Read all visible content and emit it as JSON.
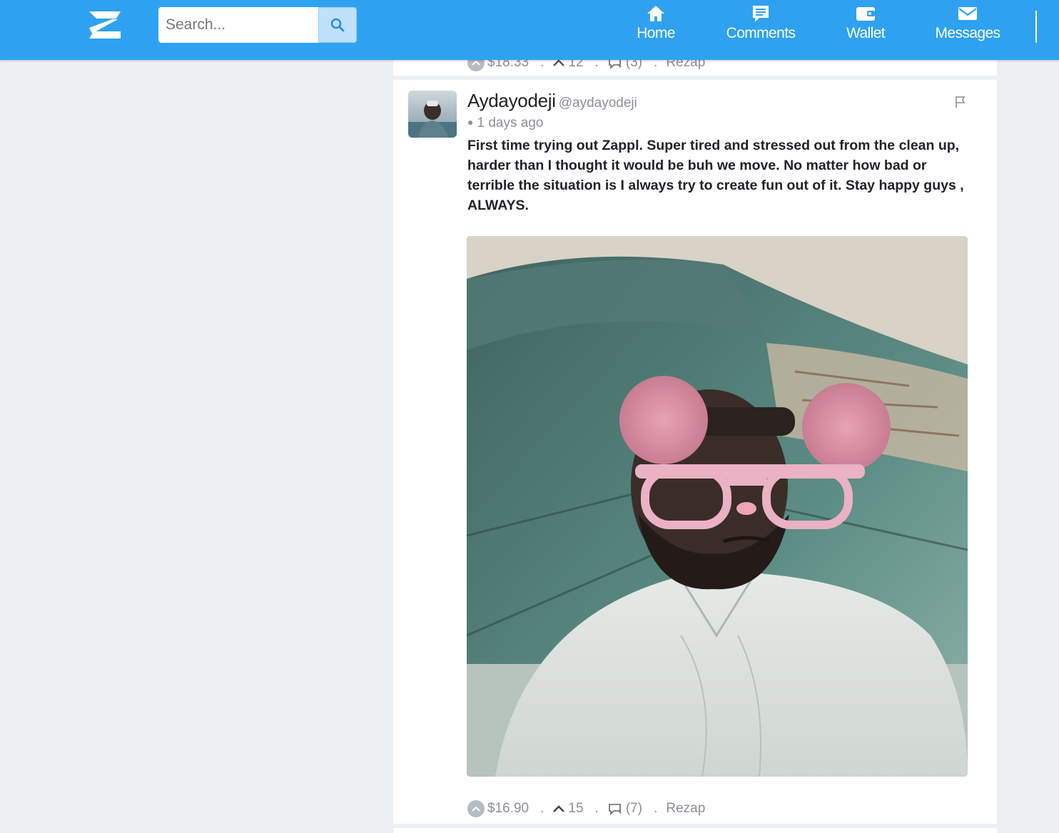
{
  "app": {
    "name": "Zappl"
  },
  "search": {
    "placeholder": "Search..."
  },
  "nav": {
    "items": [
      {
        "label": "Home",
        "icon": "home-icon"
      },
      {
        "label": "Comments",
        "icon": "comment-icon"
      },
      {
        "label": "Wallet",
        "icon": "wallet-icon"
      },
      {
        "label": "Messages",
        "icon": "envelope-icon"
      }
    ]
  },
  "previous_post": {
    "payout": "$18.33",
    "upvotes": "12",
    "comments": "(3)",
    "rezap": "Rezap"
  },
  "post": {
    "author_name": "Aydayodeji",
    "author_handle": "@aydayodeji",
    "time": "1 days ago",
    "text": "First time trying out Zappl. Super tired and stressed out from the clean up, harder than I thought it would be buh we move. No matter how bad or terrible the situation is I always try to create fun out of it. Stay happy guys , ALWAYS.",
    "payout": "$16.90",
    "upvotes": "15",
    "comments": "(7)",
    "rezap": "Rezap",
    "separator": "."
  },
  "colors": {
    "navbar": "#2ea2f0",
    "page_background": "#ecf0f3",
    "muted_text": "#8a8f96"
  }
}
